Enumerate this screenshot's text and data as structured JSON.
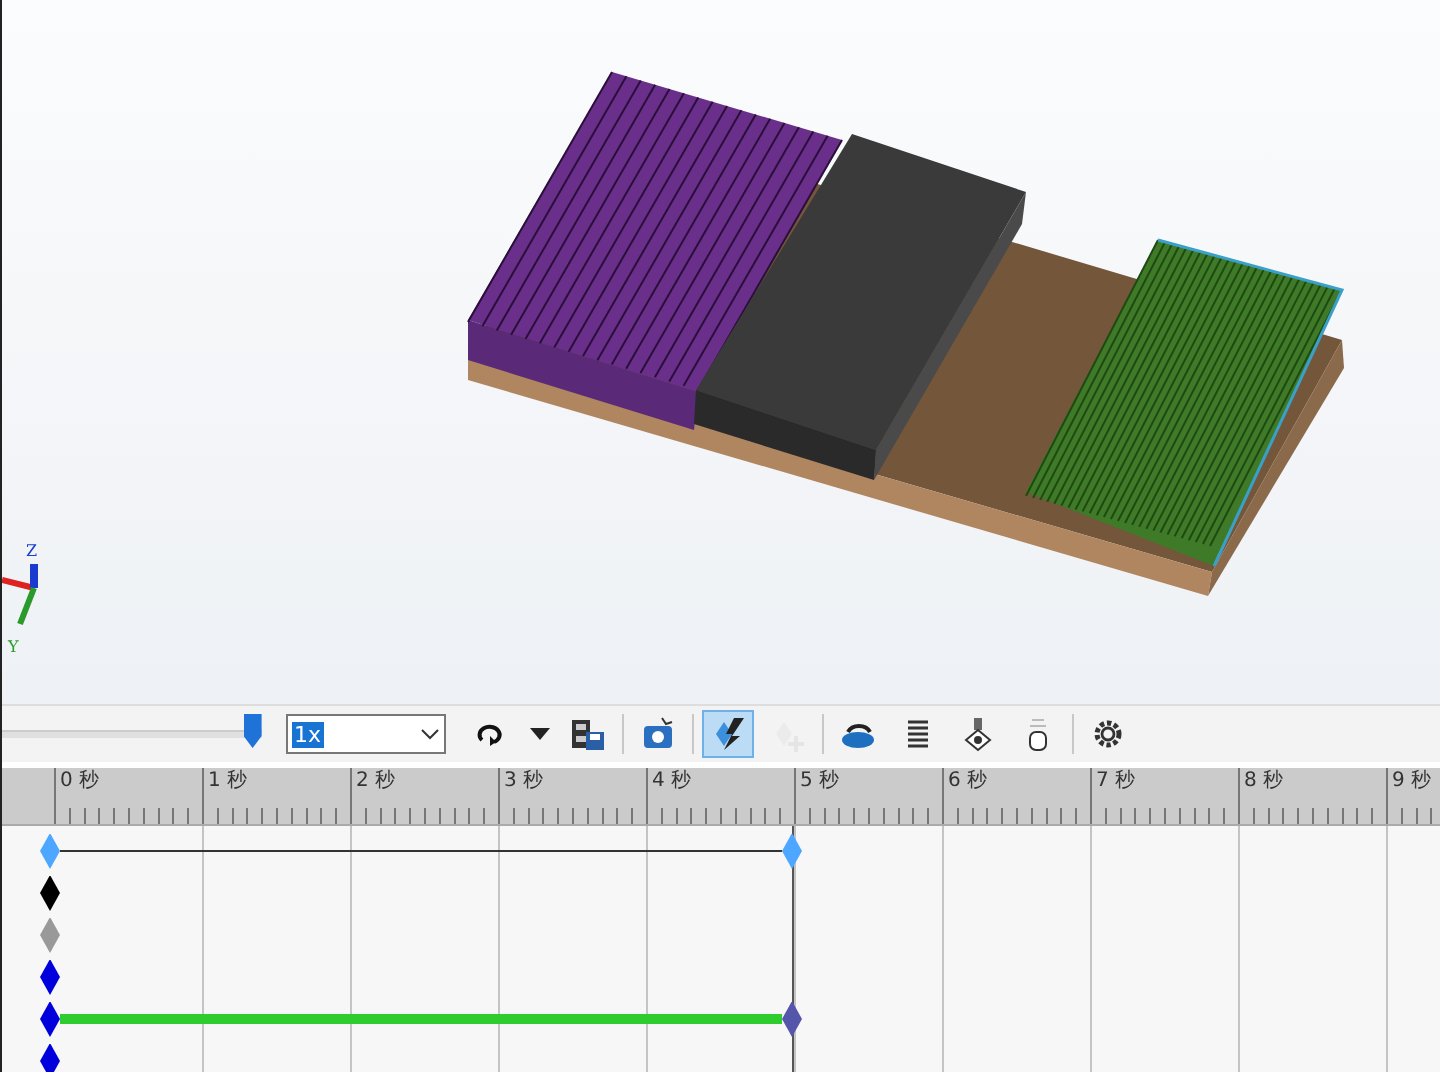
{
  "viewport": {
    "axis_labels": [
      "Z",
      "Y"
    ]
  },
  "toolbar": {
    "time_slider": {
      "level": 0.96
    },
    "speed": {
      "value": "1x"
    },
    "tool_groups": [
      [
        {
          "kind": "loop",
          "selected": false,
          "disabled": false
        },
        {
          "kind": "dropdown",
          "selected": false,
          "disabled": false
        },
        {
          "kind": "save-animation",
          "selected": false,
          "disabled": false
        }
      ],
      [
        {
          "kind": "render",
          "selected": false,
          "disabled": false
        }
      ],
      [
        {
          "kind": "autokey",
          "selected": true,
          "disabled": false
        },
        {
          "kind": "add-key",
          "selected": false,
          "disabled": true
        }
      ],
      [
        {
          "kind": "motor",
          "selected": false,
          "disabled": false
        },
        {
          "kind": "spring",
          "selected": false,
          "disabled": false
        },
        {
          "kind": "contact",
          "selected": false,
          "disabled": false
        },
        {
          "kind": "gravity",
          "selected": false,
          "disabled": false
        }
      ],
      [
        {
          "kind": "settings",
          "selected": false,
          "disabled": false
        }
      ]
    ]
  },
  "timeline": {
    "ruler": [
      "0 秒",
      "1 秒",
      "2 秒",
      "3 秒",
      "4 秒",
      "5 秒",
      "6 秒",
      "7 秒",
      "8 秒",
      "9 秒"
    ],
    "tracks": [
      {
        "kind": "line",
        "keys": [
          {
            "color": "#4da6ff"
          },
          {
            "color": "#4da6ff"
          }
        ]
      },
      {
        "kind": "single",
        "keys": [
          {
            "color": "#000000"
          }
        ]
      },
      {
        "kind": "single",
        "keys": [
          {
            "color": "#999999"
          }
        ]
      },
      {
        "kind": "single",
        "keys": [
          {
            "color": "#0000dd"
          }
        ]
      },
      {
        "kind": "bar",
        "keys": [
          {
            "color": "#0000dd"
          },
          {
            "color": "#5555aa"
          }
        ]
      },
      {
        "kind": "single",
        "keys": [
          {
            "color": "#0000dd"
          }
        ]
      }
    ]
  }
}
